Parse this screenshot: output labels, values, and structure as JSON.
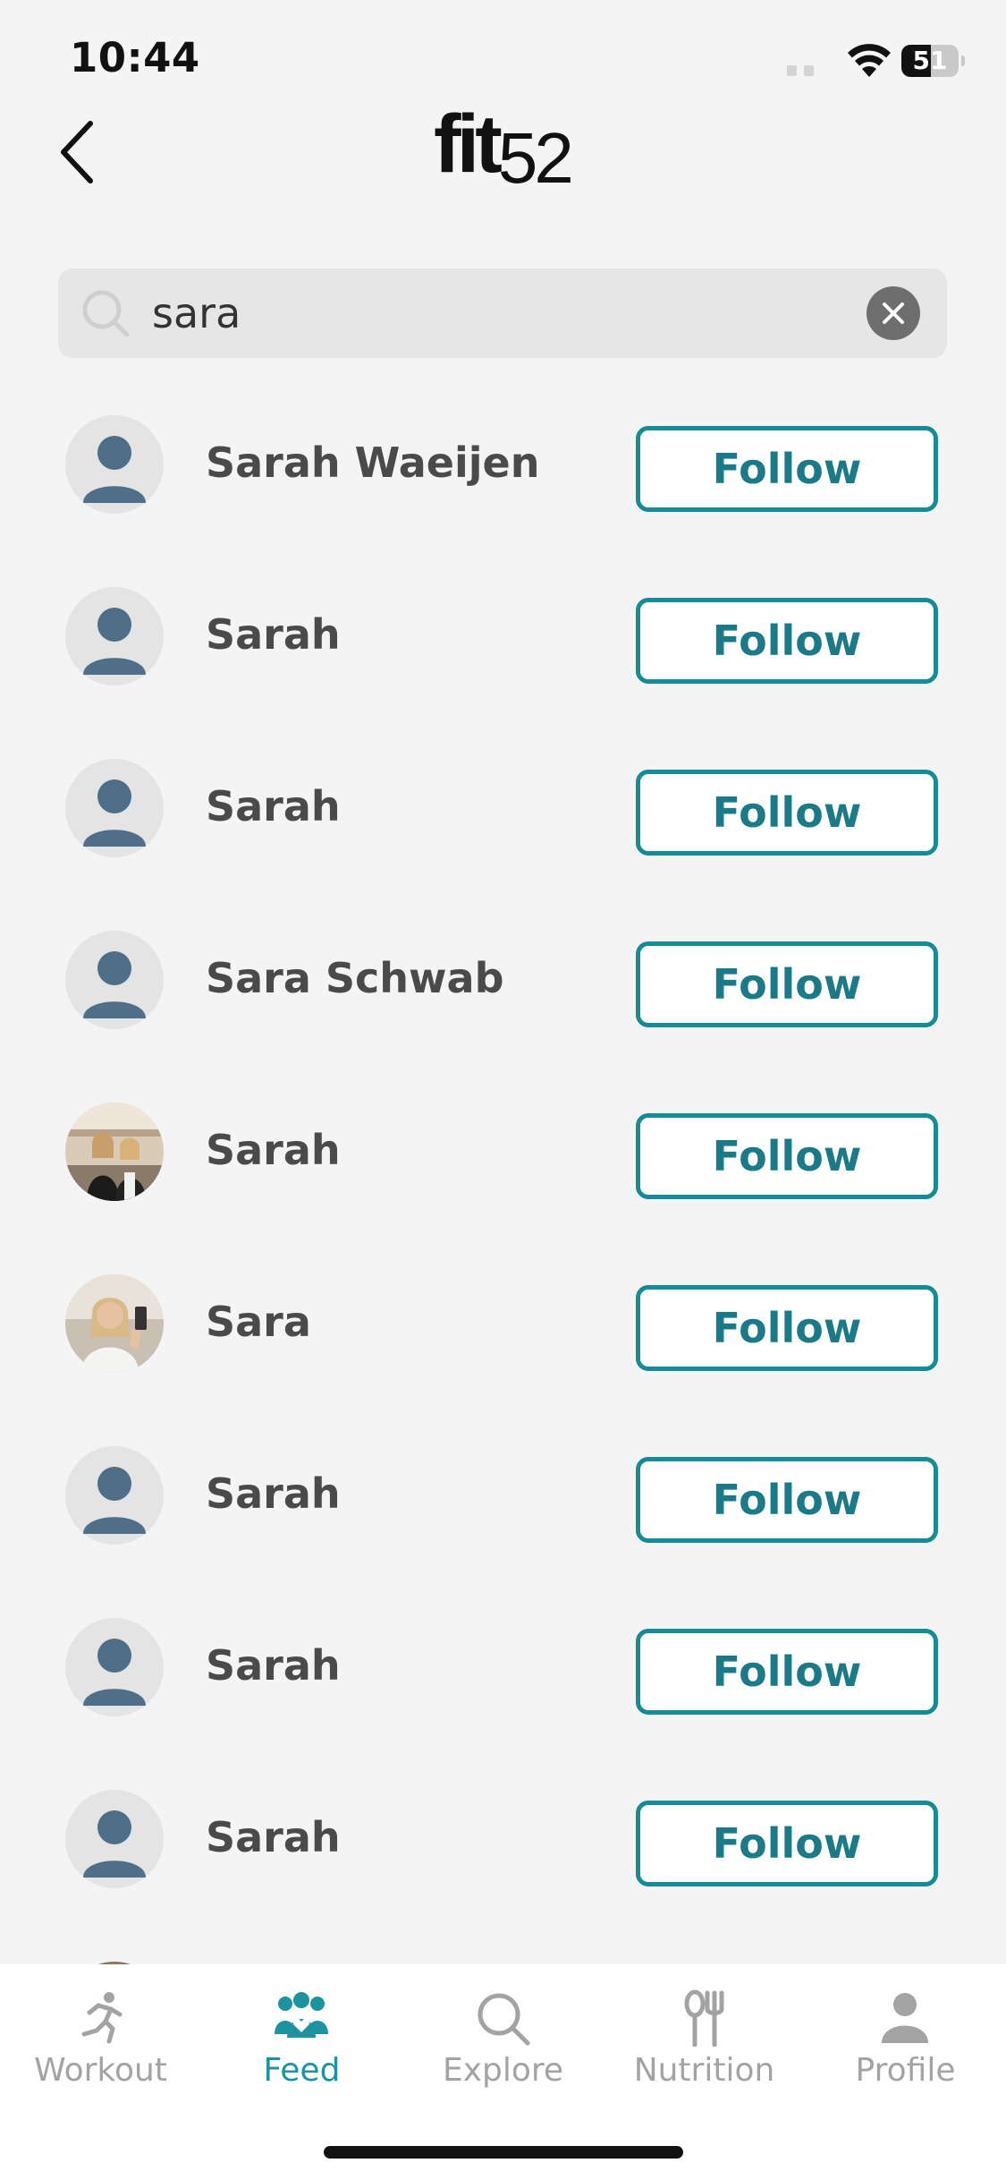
{
  "status_bar": {
    "time": "10:44",
    "battery_level": "51"
  },
  "header": {
    "logo_main": "fit",
    "logo_num": "52"
  },
  "search": {
    "value": "sara",
    "placeholder": ""
  },
  "results": [
    {
      "name": "Sarah Waeijen",
      "button": "Follow"
    },
    {
      "name": "Sarah",
      "button": "Follow"
    },
    {
      "name": "Sarah",
      "button": "Follow"
    },
    {
      "name": "Sara Schwab",
      "button": "Follow"
    },
    {
      "name": "Sarah",
      "button": "Follow"
    },
    {
      "name": "Sara",
      "button": "Follow"
    },
    {
      "name": "Sarah",
      "button": "Follow"
    },
    {
      "name": "Sarah",
      "button": "Follow"
    },
    {
      "name": "Sarah",
      "button": "Follow"
    }
  ],
  "tabs": [
    {
      "label": "Workout",
      "icon": "running-person-icon",
      "active": false
    },
    {
      "label": "Feed",
      "icon": "people-heart-icon",
      "active": true
    },
    {
      "label": "Explore",
      "icon": "magnifier-icon",
      "active": false
    },
    {
      "label": "Nutrition",
      "icon": "fork-knife-icon",
      "active": false
    },
    {
      "label": "Profile",
      "icon": "person-icon",
      "active": false
    }
  ],
  "colors": {
    "accent": "#168b93",
    "accent_text": "#1a7a88",
    "tab_active": "#1e93a0",
    "tab_inactive": "#a3a3a3",
    "avatar_figure": "#4f6f89",
    "background": "#f4f4f4"
  }
}
